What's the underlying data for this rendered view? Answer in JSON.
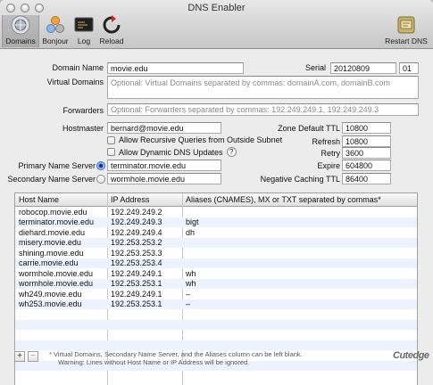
{
  "window": {
    "title": "DNS Enabler"
  },
  "toolbar": {
    "domains": "Domains",
    "bonjour": "Bonjour",
    "log": "Log",
    "reload": "Reload",
    "restart": "Restart DNS"
  },
  "form": {
    "domain_name_label": "Domain Name",
    "domain_name": "movie.edu",
    "serial_label": "Serial",
    "serial": "20120809",
    "serial_suffix": "01",
    "virtual_domains_label": "Virtual Domains",
    "virtual_domains_placeholder": "Optional: Virtual Domains separated by commas: domainA.com, domainB.com",
    "forwarders_label": "Forwarders",
    "forwarders_placeholder": "Optional: Forwarders separated by commas: 192.249.249.1, 192.249.249.3",
    "hostmaster_label": "Hostmaster",
    "hostmaster": "bernard@movie.edu",
    "allow_recursive_label": "Allow Recursive Queries from Outside Subnet",
    "allow_dynamic_label": "Allow Dynamic DNS Updates",
    "help_glyph": "?",
    "primary_ns_label": "Primary Name Server",
    "primary_ns": "terminator.movie.edu",
    "secondary_ns_label": "Secondary Name Server",
    "secondary_ns": "wormhole.movie.edu",
    "zone_ttl_label": "Zone Default TTL",
    "zone_ttl": "10800",
    "refresh_label": "Refresh",
    "refresh": "10800",
    "retry_label": "Retry",
    "retry": "3600",
    "expire_label": "Expire",
    "expire": "604800",
    "neg_ttl_label": "Negative Caching TTL",
    "neg_ttl": "86400"
  },
  "table": {
    "headers": [
      "Host Name",
      "IP Address",
      "Aliases (CNAMES), MX or TXT separated by commas*"
    ],
    "rows": [
      [
        "robocop.movie.edu",
        "192.249.249.2",
        ""
      ],
      [
        "terminator.movie.edu",
        "192.249.249.3",
        "bigt"
      ],
      [
        "diehard.movie.edu",
        "192.249.249.4",
        "dh"
      ],
      [
        "misery.movie.edu",
        "192.253.253.2",
        ""
      ],
      [
        "shining.movie.edu",
        "192.253.253.3",
        ""
      ],
      [
        "carrie.movie.edu",
        "192.253.253.4",
        ""
      ],
      [
        "wormhole.movie.edu",
        "192.249.249.1",
        "wh"
      ],
      [
        "wormhole.movie.edu",
        "192.253.253.1",
        "wh"
      ],
      [
        "wh249.movie.edu",
        "192.249.249.1",
        "–"
      ],
      [
        "wh253.movie.edu",
        "192.253.253.1",
        "–"
      ]
    ],
    "empty_rows": 7
  },
  "footer": {
    "add": "+",
    "remove": "−",
    "note_line1": "* Virtual Domains, Secondary Name Server, and the Aliases column can be left blank.",
    "note_line2": "Warning: Lines without Host Name or IP Address will be ignored.",
    "brand": "Cutedge"
  }
}
